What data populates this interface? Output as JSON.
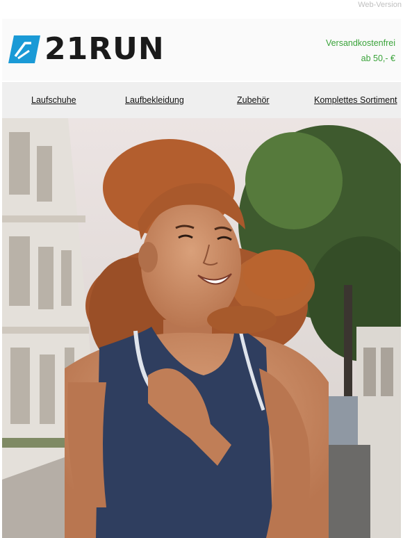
{
  "topbar": {
    "web_version_label": "Web-Version"
  },
  "header": {
    "logo_text": "21RUN",
    "shipping_line1": "Versandkostenfrei",
    "shipping_line2": "ab 50,- €",
    "accent_color": "#3aa33a",
    "logo_color": "#1a9ad6"
  },
  "nav": {
    "items": [
      {
        "label": "Laufschuhe"
      },
      {
        "label": "Laufbekleidung"
      },
      {
        "label": "Zubehör"
      },
      {
        "label": "Komplettes Sortiment"
      }
    ]
  }
}
